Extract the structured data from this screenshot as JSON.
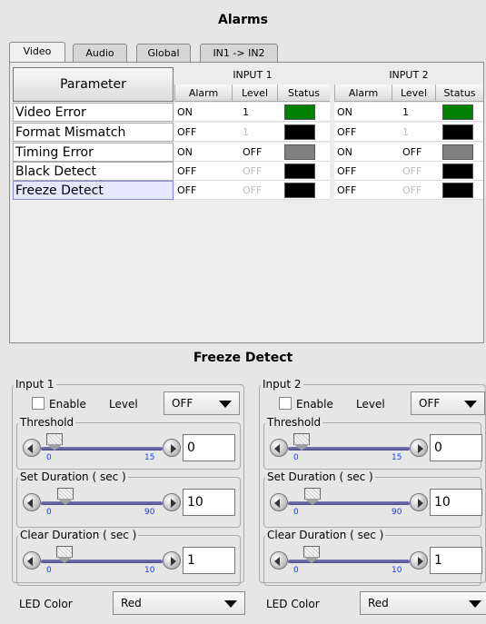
{
  "header": {
    "title": "Alarms"
  },
  "tabs": [
    {
      "label": "Video",
      "active": true
    },
    {
      "label": "Audio",
      "active": false
    },
    {
      "label": "Global",
      "active": false
    },
    {
      "label": "IN1 -> IN2",
      "active": false
    }
  ],
  "table": {
    "param_header": "Parameter",
    "input1_header": "INPUT 1",
    "input2_header": "INPUT 2",
    "sub_headers": {
      "alarm": "Alarm",
      "level": "Level",
      "status": "Status"
    },
    "rows": [
      {
        "name": "Video Error",
        "in1": {
          "alarm": "ON",
          "level": "1",
          "level_dim": false,
          "status_color": "#008000"
        },
        "in2": {
          "alarm": "ON",
          "level": "1",
          "level_dim": false,
          "status_color": "#008000"
        }
      },
      {
        "name": "Format Mismatch",
        "in1": {
          "alarm": "OFF",
          "level": "1",
          "level_dim": true,
          "status_color": "#000000"
        },
        "in2": {
          "alarm": "OFF",
          "level": "1",
          "level_dim": true,
          "status_color": "#000000"
        }
      },
      {
        "name": "Timing Error",
        "in1": {
          "alarm": "ON",
          "level": "OFF",
          "level_dim": false,
          "status_color": "#808080"
        },
        "in2": {
          "alarm": "ON",
          "level": "OFF",
          "level_dim": false,
          "status_color": "#808080"
        }
      },
      {
        "name": "Black Detect",
        "in1": {
          "alarm": "OFF",
          "level": "OFF",
          "level_dim": true,
          "status_color": "#000000"
        },
        "in2": {
          "alarm": "OFF",
          "level": "OFF",
          "level_dim": true,
          "status_color": "#000000"
        }
      },
      {
        "name": "Freeze Detect",
        "selected": true,
        "in1": {
          "alarm": "OFF",
          "level": "OFF",
          "level_dim": true,
          "status_color": "#000000"
        },
        "in2": {
          "alarm": "OFF",
          "level": "OFF",
          "level_dim": true,
          "status_color": "#000000"
        }
      }
    ]
  },
  "detail": {
    "title": "Freeze Detect",
    "inputs": [
      {
        "label": "Input 1",
        "enable_label": "Enable",
        "enabled": false,
        "level_label": "Level",
        "level_value": "OFF",
        "threshold": {
          "label": "Threshold",
          "min": "0",
          "max": "15",
          "value": "0",
          "fraction": 0.0
        },
        "set_duration": {
          "label": "Set Duration ( sec )",
          "min": "0",
          "max": "90",
          "value": "10",
          "fraction": 0.11
        },
        "clear_duration": {
          "label": "Clear Duration ( sec )",
          "min": "0",
          "max": "10",
          "value": "1",
          "fraction": 0.1
        },
        "led_label": "LED Color",
        "led_value": "Red"
      },
      {
        "label": "Input 2",
        "enable_label": "Enable",
        "enabled": false,
        "level_label": "Level",
        "level_value": "OFF",
        "threshold": {
          "label": "Threshold",
          "min": "0",
          "max": "15",
          "value": "0",
          "fraction": 0.0
        },
        "set_duration": {
          "label": "Set Duration ( sec )",
          "min": "0",
          "max": "90",
          "value": "10",
          "fraction": 0.11
        },
        "clear_duration": {
          "label": "Clear Duration ( sec )",
          "min": "0",
          "max": "10",
          "value": "1",
          "fraction": 0.1
        },
        "led_label": "LED Color",
        "led_value": "Red"
      }
    ]
  }
}
